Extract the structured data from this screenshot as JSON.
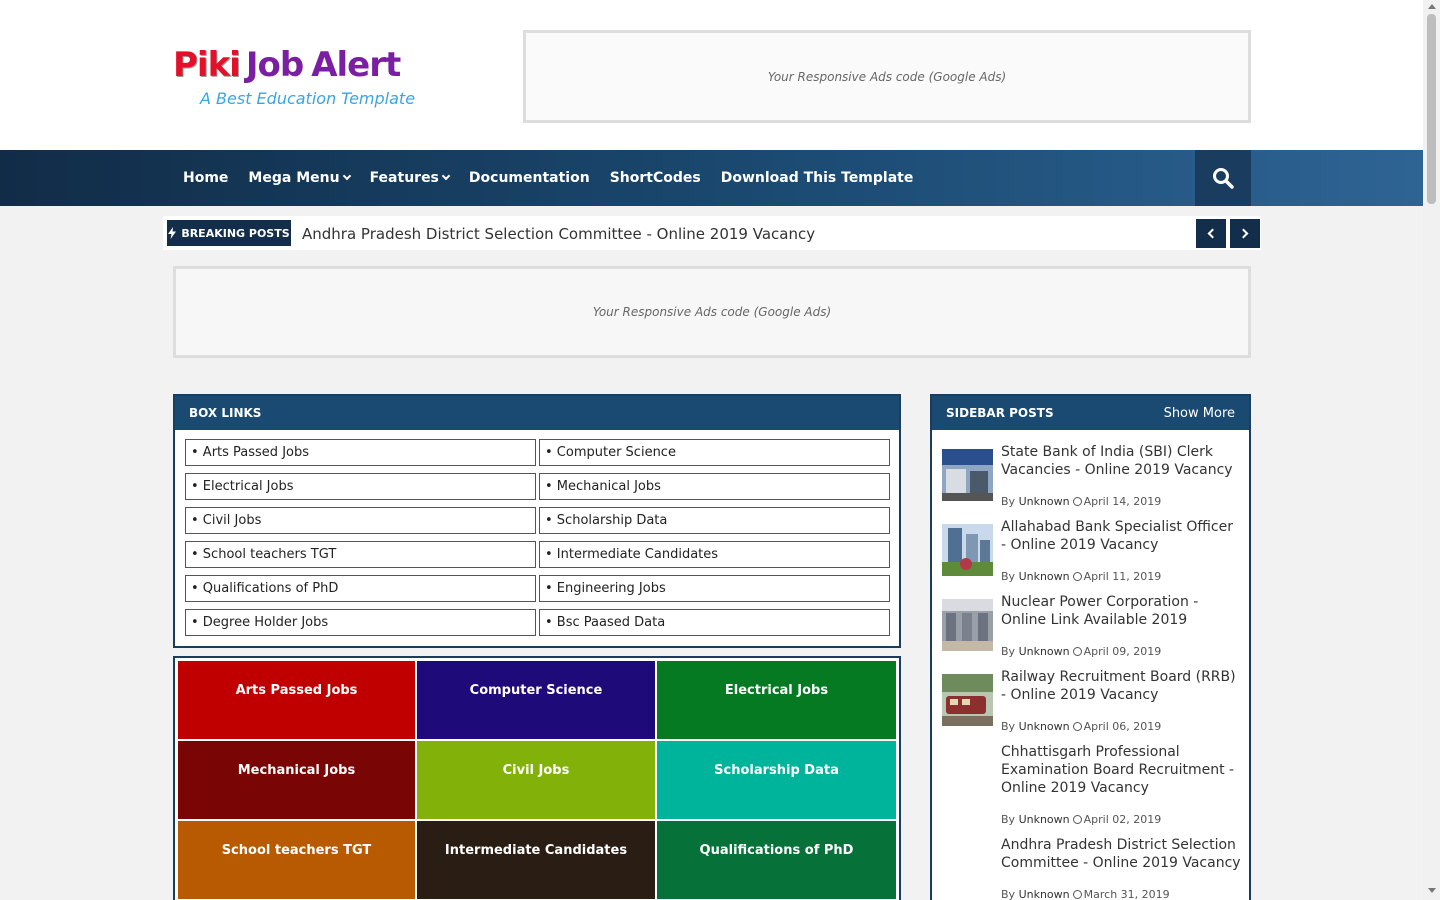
{
  "logo": {
    "brand_first": "Piki",
    "brand_second": "Job",
    "brand_third": "Alert",
    "tagline": "A Best Education Template"
  },
  "ads": {
    "top": "Your Responsive Ads code (Google Ads)",
    "mid": "Your Responsive Ads code (Google Ads)"
  },
  "nav": {
    "items": [
      {
        "label": "Home",
        "dropdown": false
      },
      {
        "label": "Mega Menu",
        "dropdown": true
      },
      {
        "label": "Features",
        "dropdown": true
      },
      {
        "label": "Documentation",
        "dropdown": false
      },
      {
        "label": "ShortCodes",
        "dropdown": false
      },
      {
        "label": "Download This Template",
        "dropdown": false
      }
    ]
  },
  "breaking": {
    "label": "BREAKING POSTS",
    "text": "Andhra Pradesh District Selection Committee - Online 2019 Vacancy"
  },
  "box_links": {
    "title": "BOX LINKS",
    "items": [
      "• Arts Passed Jobs",
      "• Computer Science",
      "• Electrical Jobs",
      "• Mechanical Jobs",
      "• Civil Jobs",
      "• Scholarship Data",
      "• School teachers TGT",
      "• Intermediate Candidates",
      "• Qualifications of PhD",
      "• Engineering Jobs",
      "• Degree Holder Jobs",
      "• Bsc Paased Data"
    ]
  },
  "tiles": [
    {
      "label": "Arts Passed Jobs",
      "color": "#c00000"
    },
    {
      "label": "Computer Science",
      "color": "#1f0a7a"
    },
    {
      "label": "Electrical Jobs",
      "color": "#067a22"
    },
    {
      "label": "Mechanical Jobs",
      "color": "#7a0505"
    },
    {
      "label": "Civil Jobs",
      "color": "#82b20a"
    },
    {
      "label": "Scholarship Data",
      "color": "#00b49c"
    },
    {
      "label": "School teachers TGT",
      "color": "#b85a02"
    },
    {
      "label": "Intermediate Candidates",
      "color": "#2a1e14"
    },
    {
      "label": "Qualifications of PhD",
      "color": "#06723a"
    }
  ],
  "sidebar": {
    "title": "SIDEBAR POSTS",
    "show_more": "Show More",
    "posts": [
      {
        "title": "State Bank of India (SBI) Clerk Vacancies - Online 2019 Vacancy",
        "by": "By",
        "author": "Unknown",
        "date": "April 14, 2019",
        "thumb": "bank-building"
      },
      {
        "title": "Allahabad Bank Specialist Officer - Online 2019 Vacancy",
        "by": "By",
        "author": "Unknown",
        "date": "April 11, 2019",
        "thumb": "office-towers"
      },
      {
        "title": "Nuclear Power Corporation - Online Link Available 2019",
        "by": "By",
        "author": "Unknown",
        "date": "April 09, 2019",
        "thumb": "station-hall"
      },
      {
        "title": "Railway Recruitment Board (RRB) - Online 2019 Vacancy",
        "by": "By",
        "author": "Unknown",
        "date": "April 06, 2019",
        "thumb": "train"
      },
      {
        "title": "Chhattisgarh Professional Examination Board Recruitment - Online 2019 Vacancy",
        "by": "By",
        "author": "Unknown",
        "date": "April 02, 2019",
        "thumb": ""
      },
      {
        "title": "Andhra Pradesh District Selection Committee - Online 2019 Vacancy",
        "by": "By",
        "author": "Unknown",
        "date": "March 31, 2019",
        "thumb": ""
      }
    ]
  }
}
